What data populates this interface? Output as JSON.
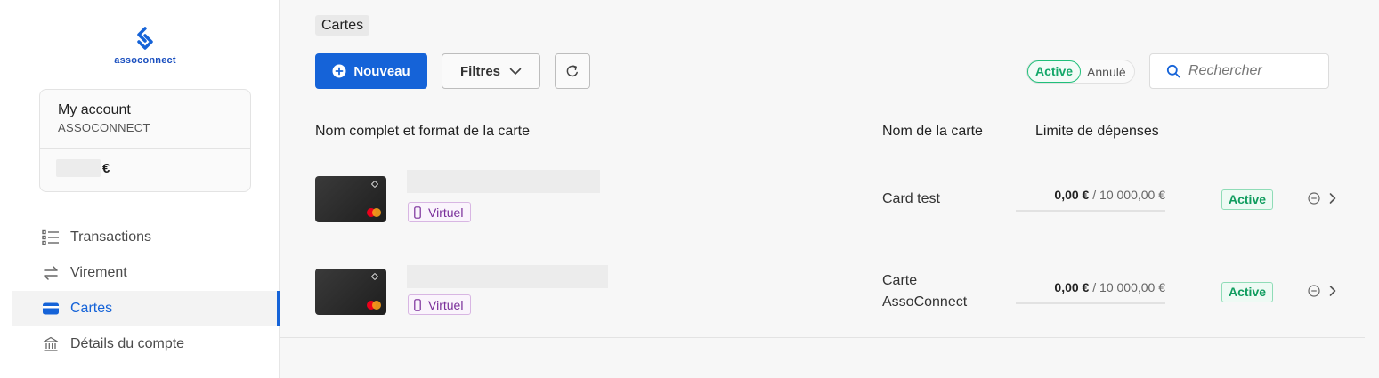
{
  "brand": {
    "name": "assoconnect",
    "color": "#1563d8"
  },
  "account": {
    "title": "My account",
    "subtitle": "ASSOCONNECT",
    "currency": "€"
  },
  "nav": [
    {
      "label": "Transactions",
      "icon": "list-icon",
      "active": false
    },
    {
      "label": "Virement",
      "icon": "transfer-arrows-icon",
      "active": false
    },
    {
      "label": "Cartes",
      "icon": "credit-card-icon",
      "active": true
    },
    {
      "label": "Détails du compte",
      "icon": "bank-icon",
      "active": false
    }
  ],
  "breadcrumb": "Cartes",
  "toolbar": {
    "new_label": "Nouveau",
    "filter_label": "Filtres",
    "status_active": "Active",
    "status_cancelled": "Annulé",
    "search_placeholder": "Rechercher"
  },
  "table": {
    "headers": {
      "card": "Nom complet et format de la carte",
      "name": "Nom de la carte",
      "limit": "Limite de dépenses"
    },
    "rows": [
      {
        "format": "Virtuel",
        "card_name": "Card test",
        "spent": "0,00 €",
        "limit": "/ 10 000,00 €",
        "status": "Active"
      },
      {
        "format": "Virtuel",
        "card_name": "Carte AssoConnect",
        "spent": "0,00 €",
        "limit": "/ 10 000,00 €",
        "status": "Active"
      }
    ]
  },
  "colors": {
    "accent": "#1563d8",
    "success": "#0f9c5e",
    "virtual_tag": "#7a2e9a"
  }
}
